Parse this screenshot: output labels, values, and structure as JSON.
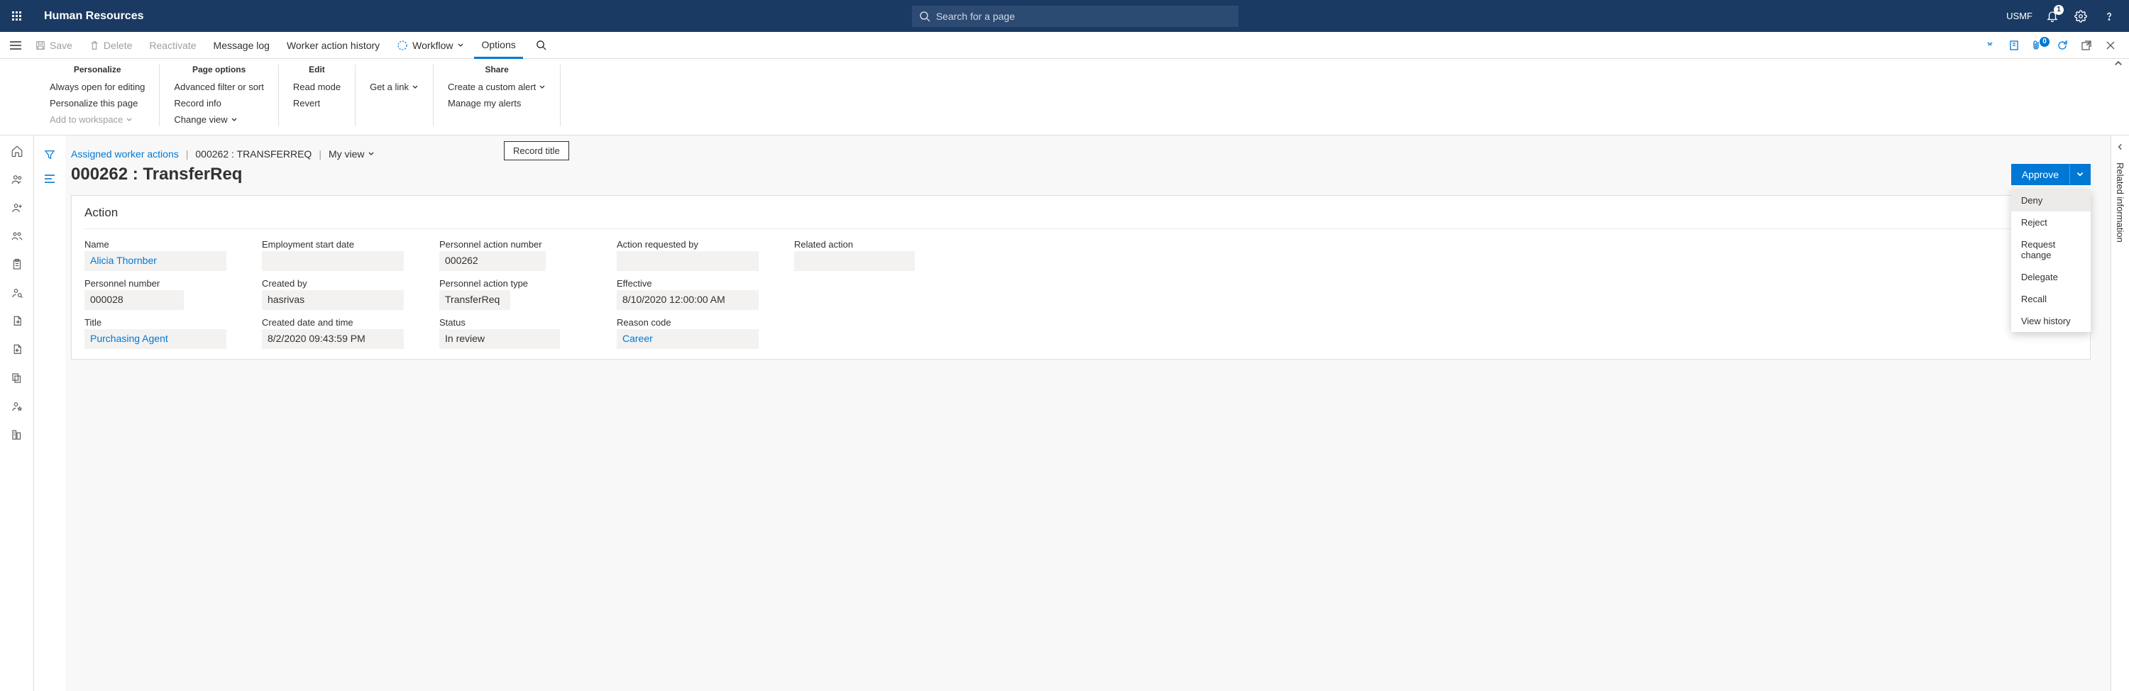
{
  "header": {
    "app_title": "Human Resources",
    "search_placeholder": "Search for a page",
    "legal_entity": "USMF",
    "notification_count": "1"
  },
  "toolbar": {
    "save": "Save",
    "delete": "Delete",
    "reactivate": "Reactivate",
    "message_log": "Message log",
    "worker_action_history": "Worker action history",
    "workflow": "Workflow",
    "options": "Options",
    "attachment_count": "0"
  },
  "ribbon": {
    "personalize": {
      "title": "Personalize",
      "always_open": "Always open for editing",
      "personalize_page": "Personalize this page",
      "add_workspace": "Add to workspace"
    },
    "page_options": {
      "title": "Page options",
      "adv_filter": "Advanced filter or sort",
      "record_info": "Record info",
      "change_view": "Change view"
    },
    "edit": {
      "title": "Edit",
      "read_mode": "Read mode",
      "revert": "Revert"
    },
    "get_link": {
      "get_link": "Get a link"
    },
    "share": {
      "title": "Share",
      "create_alert": "Create a custom alert",
      "manage_alerts": "Manage my alerts"
    }
  },
  "breadcrumb": {
    "link": "Assigned worker actions",
    "current": "000262 : TRANSFERREQ",
    "my_view": "My view"
  },
  "record_title_tooltip": "Record title",
  "record": {
    "title": "000262 : TransferReq",
    "approve_label": "Approve",
    "dropdown": [
      "Deny",
      "Reject",
      "Request change",
      "Delegate",
      "Recall",
      "View history"
    ]
  },
  "action_section": {
    "title": "Action",
    "timestamp": "8/10/2020 12:0",
    "fields": {
      "name": {
        "label": "Name",
        "value": "Alicia Thornber"
      },
      "personnel_number": {
        "label": "Personnel number",
        "value": "000028"
      },
      "title": {
        "label": "Title",
        "value": "Purchasing Agent"
      },
      "employment_start": {
        "label": "Employment start date",
        "value": ""
      },
      "created_by": {
        "label": "Created by",
        "value": "hasrivas"
      },
      "created_date": {
        "label": "Created date and time",
        "value": "8/2/2020 09:43:59 PM"
      },
      "action_number": {
        "label": "Personnel action number",
        "value": "000262"
      },
      "action_type": {
        "label": "Personnel action type",
        "value": "TransferReq"
      },
      "status": {
        "label": "Status",
        "value": "In review"
      },
      "requested_by": {
        "label": "Action requested by",
        "value": ""
      },
      "effective": {
        "label": "Effective",
        "value": "8/10/2020 12:00:00 AM"
      },
      "reason_code": {
        "label": "Reason code",
        "value": "Career"
      },
      "related_action": {
        "label": "Related action",
        "value": ""
      }
    }
  },
  "right_rail": {
    "related_info": "Related information"
  }
}
